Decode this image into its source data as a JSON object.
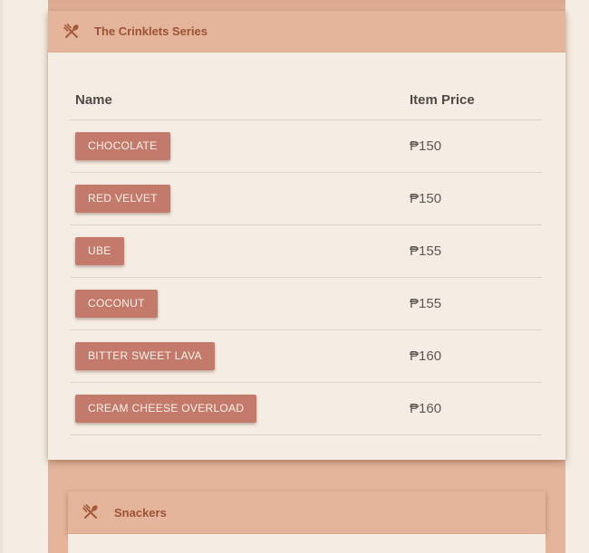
{
  "colors": {
    "page_background": "#f5ede3",
    "accent": "#e4b59b",
    "button": "#c47a6b",
    "title_text": "#9c5236"
  },
  "sections": [
    {
      "title": "The Crinklets Series",
      "icon": "utensils-icon",
      "columns": [
        "Name",
        "Item Price"
      ],
      "items": [
        {
          "name": "CHOCOLATE",
          "price": "₱150"
        },
        {
          "name": "RED VELVET",
          "price": "₱150"
        },
        {
          "name": "UBE",
          "price": "₱155"
        },
        {
          "name": "COCONUT",
          "price": "₱155"
        },
        {
          "name": "BITTER SWEET LAVA",
          "price": "₱160"
        },
        {
          "name": "CREAM CHEESE OVERLOAD",
          "price": "₱160"
        }
      ]
    },
    {
      "title": "Snackers",
      "icon": "utensils-icon"
    }
  ]
}
